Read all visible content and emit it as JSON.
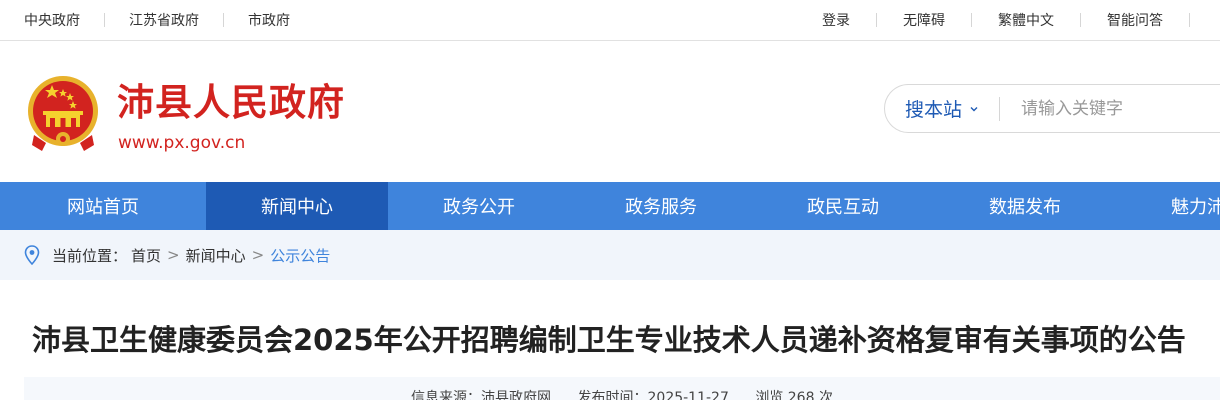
{
  "topbar": {
    "left_links": [
      "中央政府",
      "江苏省政府",
      "市政府"
    ],
    "right_links": [
      "登录",
      "无障碍",
      "繁體中文",
      "智能问答"
    ]
  },
  "header": {
    "site_title": "沛县人民政府",
    "site_url": "www.px.gov.cn",
    "emblem_icon": "national-emblem-icon"
  },
  "search": {
    "scope_label": "搜本站",
    "placeholder": "请输入关键字"
  },
  "nav": {
    "items": [
      "网站首页",
      "新闻中心",
      "政务公开",
      "政务服务",
      "政民互动",
      "数据发布",
      "魅力沛县"
    ],
    "active_index": 1
  },
  "breadcrumb": {
    "prefix": "当前位置：",
    "items": [
      "首页",
      "新闻中心",
      "公示公告"
    ],
    "separator": ">"
  },
  "article": {
    "title": "沛县卫生健康委员会2025年公开招聘编制卫生专业技术人员递补资格复审有关事项的公告",
    "meta": {
      "source": "信息来源：沛县政府网",
      "date": "发布时间：2025-11-27",
      "views": "浏览 268 次"
    }
  },
  "colors": {
    "brand_red": "#d2231f",
    "nav_blue": "#3f84dc",
    "nav_active": "#1e5ab4",
    "crumb_bg": "#f1f5fb"
  }
}
